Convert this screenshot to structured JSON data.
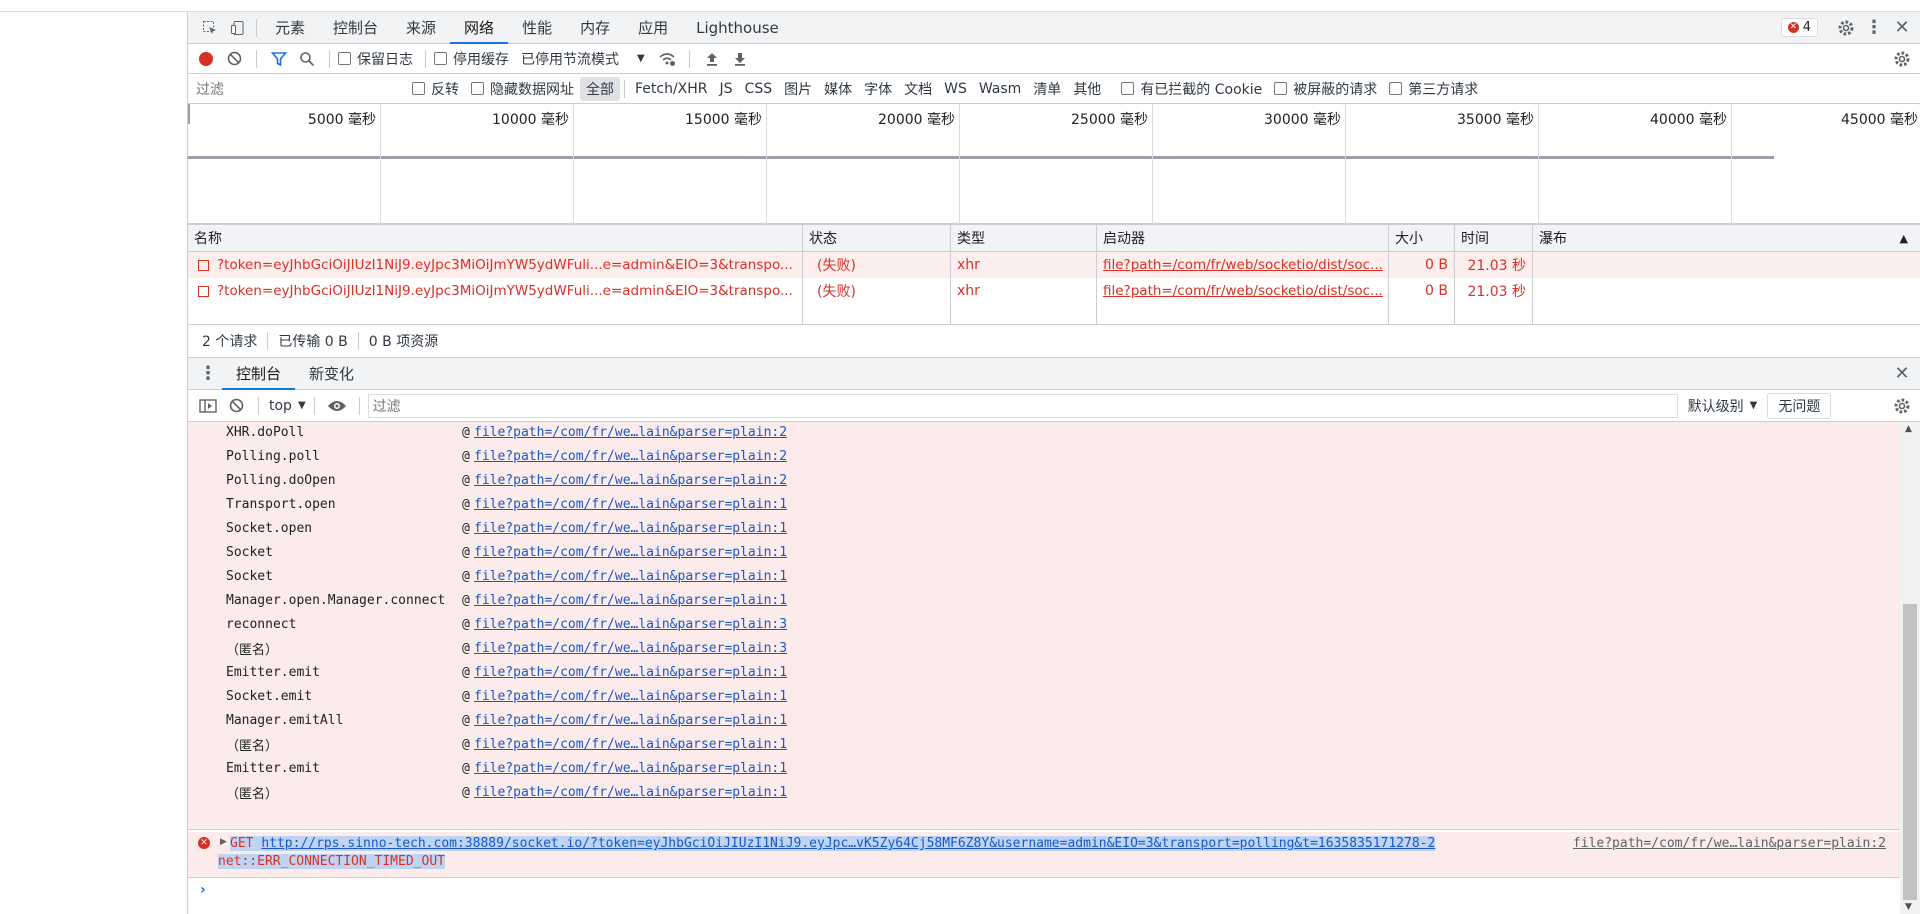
{
  "tabs": {
    "items": [
      "元素",
      "控制台",
      "来源",
      "网络",
      "性能",
      "内存",
      "应用",
      "Lighthouse"
    ],
    "active": "网络"
  },
  "error_badge": "4",
  "toolbar": {
    "preserve_log": "保留日志",
    "disable_cache": "停用缓存",
    "throttle": "已停用节流模式"
  },
  "filterbar": {
    "placeholder": "过滤",
    "invert": "反转",
    "hide_data_urls": "隐藏数据网址",
    "types": [
      "全部",
      "Fetch/XHR",
      "JS",
      "CSS",
      "图片",
      "媒体",
      "字体",
      "文档",
      "WS",
      "Wasm",
      "清单",
      "其他"
    ],
    "blocked_cookies": "有已拦截的 Cookie",
    "blocked_requests": "被屏蔽的请求",
    "third_party": "第三方请求"
  },
  "timeline_ticks": [
    "5000 毫秒",
    "10000 毫秒",
    "15000 毫秒",
    "20000 毫秒",
    "25000 毫秒",
    "30000 毫秒",
    "35000 毫秒",
    "40000 毫秒",
    "45000 毫秒"
  ],
  "table": {
    "headers": [
      "名称",
      "状态",
      "类型",
      "启动器",
      "大小",
      "时间",
      "瀑布"
    ],
    "rows": [
      {
        "name": "?token=eyJhbGciOiJIUzI1NiJ9.eyJpc3MiOiJmYW5ydWFuli...e=admin&EIO=3&transpo...",
        "status": "(失败)",
        "type": "xhr",
        "initiator": "file?path=/com/fr/web/socketio/dist/soc...",
        "size": "0 B",
        "time": "21.03 秒"
      },
      {
        "name": "?token=eyJhbGciOiJIUzI1NiJ9.eyJpc3MiOiJmYW5ydWFuli...e=admin&EIO=3&transpo...",
        "status": "(失败)",
        "type": "xhr",
        "initiator": "file?path=/com/fr/web/socketio/dist/soc...",
        "size": "0 B",
        "time": "21.03 秒"
      }
    ]
  },
  "status_bar": {
    "requests": "2 个请求",
    "transferred": "已传输 0 B",
    "resources": "0 B 项资源"
  },
  "drawer": {
    "tabs": [
      "控制台",
      "新变化"
    ],
    "context": "top",
    "filter_placeholder": "过滤",
    "level": "默认级别",
    "issues": "无问题"
  },
  "stack": [
    {
      "fn": "XHR.doPoll",
      "src": "file?path=/com/fr/we…lain&parser=plain:2"
    },
    {
      "fn": "Polling.poll",
      "src": "file?path=/com/fr/we…lain&parser=plain:2"
    },
    {
      "fn": "Polling.doOpen",
      "src": "file?path=/com/fr/we…lain&parser=plain:2"
    },
    {
      "fn": "Transport.open",
      "src": "file?path=/com/fr/we…lain&parser=plain:1"
    },
    {
      "fn": "Socket.open",
      "src": "file?path=/com/fr/we…lain&parser=plain:1"
    },
    {
      "fn": "Socket",
      "src": "file?path=/com/fr/we…lain&parser=plain:1"
    },
    {
      "fn": "Socket",
      "src": "file?path=/com/fr/we…lain&parser=plain:1"
    },
    {
      "fn": "Manager.open.Manager.connect",
      "src": "file?path=/com/fr/we…lain&parser=plain:1"
    },
    {
      "fn": "reconnect",
      "src": "file?path=/com/fr/we…lain&parser=plain:3"
    },
    {
      "fn": "（匿名）",
      "src": "file?path=/com/fr/we…lain&parser=plain:3"
    },
    {
      "fn": "Emitter.emit",
      "src": "file?path=/com/fr/we…lain&parser=plain:1"
    },
    {
      "fn": "Socket.emit",
      "src": "file?path=/com/fr/we…lain&parser=plain:1"
    },
    {
      "fn": "Manager.emitAll",
      "src": "file?path=/com/fr/we…lain&parser=plain:1"
    },
    {
      "fn": "（匿名）",
      "src": "file?path=/com/fr/we…lain&parser=plain:1"
    },
    {
      "fn": "Emitter.emit",
      "src": "file?path=/com/fr/we…lain&parser=plain:1"
    },
    {
      "fn": "（匿名）",
      "src": "file?path=/com/fr/we…lain&parser=plain:1"
    }
  ],
  "error_msg": {
    "method": "GET",
    "url": "http://rps.sinno-tech.com:38889/socket.io/?token=eyJhbGciOiJIUzI1NiJ9.eyJpc…vK5Zy64Cj58MF6Z8Y&username=admin&EIO=3&transport=polling&t=1635835171278-2",
    "source": "file?path=/com/fr/we…lain&parser=plain:2",
    "error": "net::ERR_CONNECTION_TIMED_OUT"
  },
  "colors": {
    "accent": "#1a73e8",
    "error": "#d93025",
    "error_bg": "#fcebeb"
  }
}
